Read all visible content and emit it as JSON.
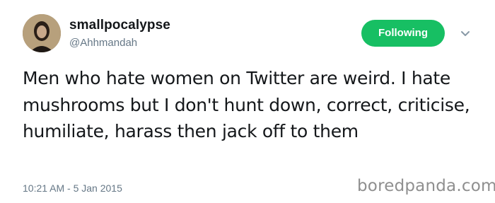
{
  "tweet": {
    "display_name": "smallpocalypse",
    "handle": "@Ahhmandah",
    "follow_button_label": "Following",
    "text": "Men who hate women on Twitter are weird. I hate mushrooms but I don't hunt down, correct, criticise, humiliate, harass then jack off to them",
    "timestamp": "10:21 AM - 5 Jan 2015",
    "avatar_icon": "profile-photo",
    "caret_icon": "chevron-down-icon"
  },
  "watermark": {
    "text": "boredpanda.com"
  },
  "colors": {
    "following_green": "#17bf63",
    "secondary_text": "#657786",
    "primary_text": "#14171a",
    "watermark": "#8f8f8f"
  }
}
